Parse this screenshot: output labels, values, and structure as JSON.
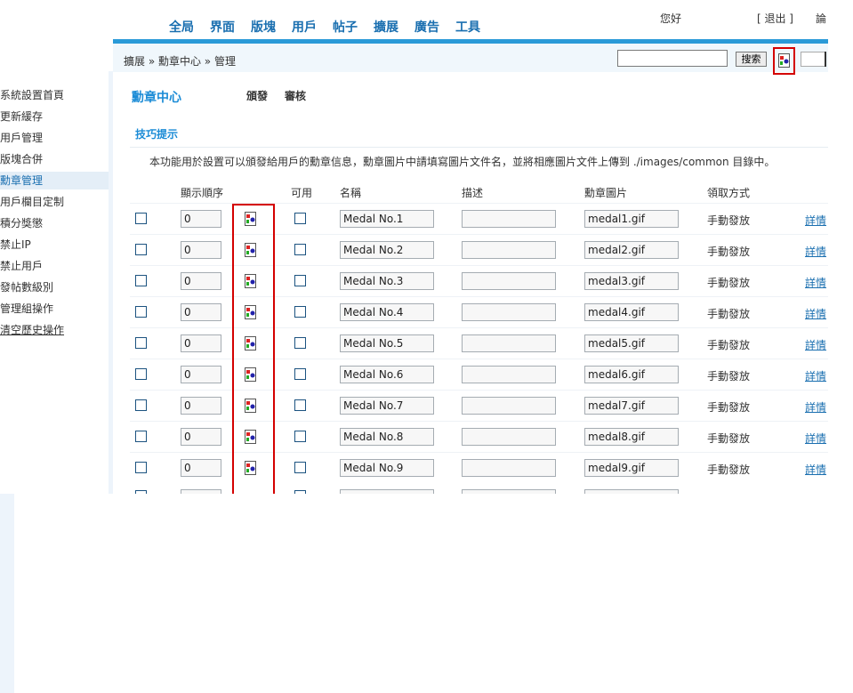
{
  "nav": {
    "tabs": [
      "全局",
      "界面",
      "版塊",
      "用戶",
      "帖子",
      "擴展",
      "廣告",
      "工具"
    ],
    "greeting": "您好",
    "logout": "[ 退出 ]",
    "forum": "論"
  },
  "breadcrumb": "擴展 » 勳章中心 » 管理",
  "search": {
    "value": "",
    "button": "搜索"
  },
  "sidebar": {
    "items": [
      "系統設置首頁",
      "更新緩存",
      "用戶管理",
      "版塊合併",
      "勳章管理",
      "用戶欄目定制",
      "積分獎懲",
      "禁止IP",
      "禁止用戶",
      "發帖數級別",
      "管理組操作",
      "清空歷史操作"
    ],
    "active_index": 4
  },
  "main": {
    "title": "勳章中心",
    "tabs": [
      "頒發",
      "審核"
    ],
    "tips_title": "技巧提示",
    "tips_text": "本功能用於設置可以頒發給用戶的勳章信息，勳章圖片中請填寫圖片文件名，並將相應圖片文件上傳到 ./images/common 目錄中。"
  },
  "table": {
    "headers": {
      "order": "顯示順序",
      "available": "可用",
      "name": "名稱",
      "description": "描述",
      "image": "勳章圖片",
      "method": "領取方式"
    },
    "rows": [
      {
        "order": "0",
        "name": "Medal No.1",
        "description": "",
        "image": "medal1.gif",
        "method": "手動發放",
        "detail": "詳情"
      },
      {
        "order": "0",
        "name": "Medal No.2",
        "description": "",
        "image": "medal2.gif",
        "method": "手動發放",
        "detail": "詳情"
      },
      {
        "order": "0",
        "name": "Medal No.3",
        "description": "",
        "image": "medal3.gif",
        "method": "手動發放",
        "detail": "詳情"
      },
      {
        "order": "0",
        "name": "Medal No.4",
        "description": "",
        "image": "medal4.gif",
        "method": "手動發放",
        "detail": "詳情"
      },
      {
        "order": "0",
        "name": "Medal No.5",
        "description": "",
        "image": "medal5.gif",
        "method": "手動發放",
        "detail": "詳情"
      },
      {
        "order": "0",
        "name": "Medal No.6",
        "description": "",
        "image": "medal6.gif",
        "method": "手動發放",
        "detail": "詳情"
      },
      {
        "order": "0",
        "name": "Medal No.7",
        "description": "",
        "image": "medal7.gif",
        "method": "手動發放",
        "detail": "詳情"
      },
      {
        "order": "0",
        "name": "Medal No.8",
        "description": "",
        "image": "medal8.gif",
        "method": "手動發放",
        "detail": "詳情"
      },
      {
        "order": "0",
        "name": "Medal No.9",
        "description": "",
        "image": "medal9.gif",
        "method": "手動發放",
        "detail": "詳情"
      }
    ]
  },
  "colors": {
    "accent": "#2a9ad8",
    "link": "#1a6fb0",
    "highlight": "#d40000"
  }
}
